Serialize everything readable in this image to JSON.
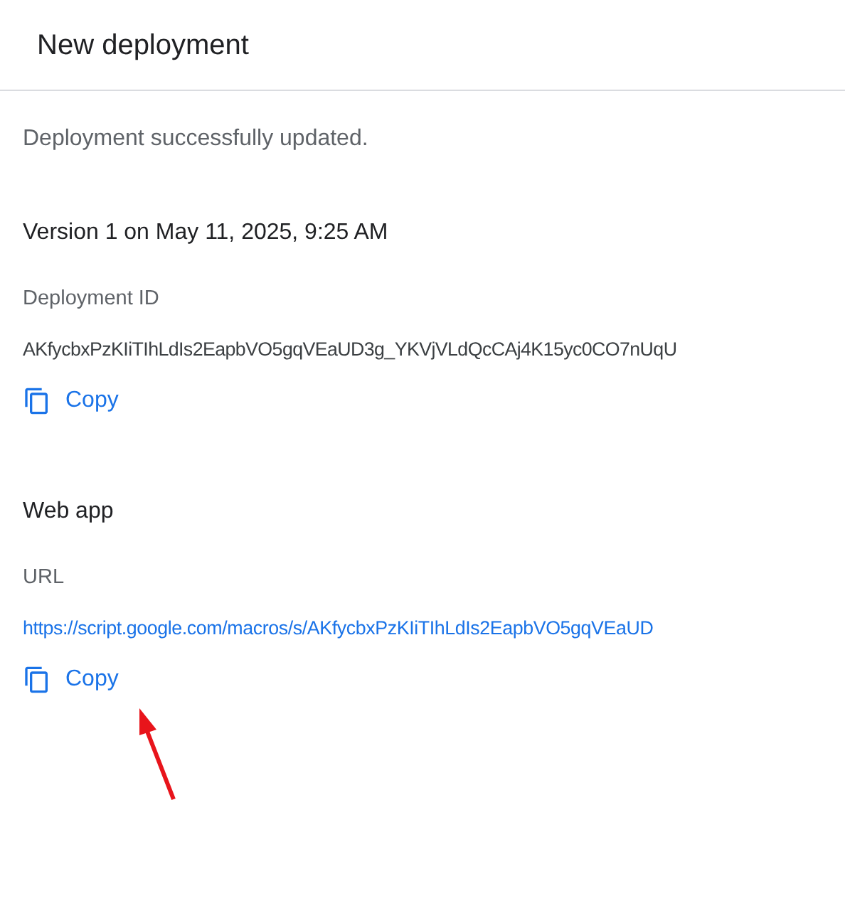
{
  "dialog": {
    "title": "New deployment"
  },
  "message": "Deployment successfully updated.",
  "version_heading": "Version 1 on May 11, 2025, 9:25 AM",
  "sections": [
    {
      "label": "Deployment ID",
      "value": "AKfycbxPzKIiTIhLdIs2EapbVO5gqVEaUD3g_YKVjVLdQcCAj4K15yc0CO7nUqU",
      "kind": "text",
      "copy": "Copy"
    },
    {
      "heading": "Web app",
      "label": "URL",
      "value": "https://script.google.com/macros/s/AKfycbxPzKIiTIhLdIs2EapbVO5gqVEaUD",
      "kind": "link",
      "copy": "Copy"
    }
  ]
}
